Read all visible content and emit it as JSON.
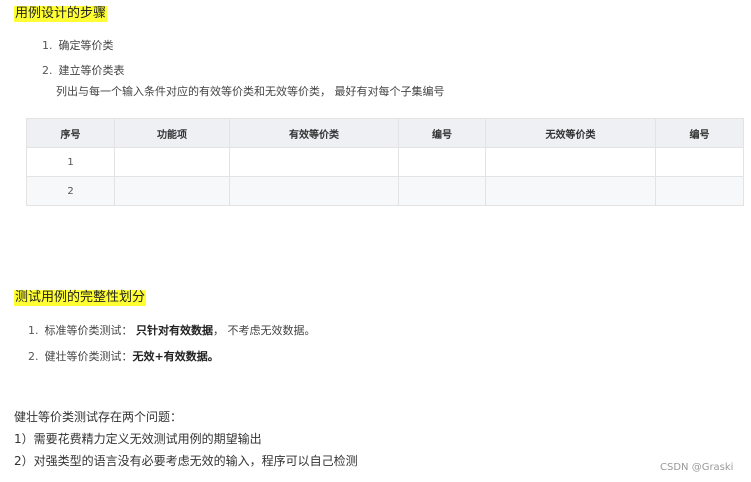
{
  "section1": {
    "title": "用例设计的步骤",
    "steps": [
      {
        "num": "1.",
        "text": "确定等价类"
      },
      {
        "num": "2.",
        "text": "建立等价类表"
      }
    ],
    "subtext": "列出与每一个输入条件对应的有效等价类和无效等价类， 最好有对每个子集编号"
  },
  "table": {
    "headers": [
      "序号",
      "功能项",
      "有效等价类",
      "编号",
      "无效等价类",
      "编号"
    ],
    "rows": [
      [
        "1",
        "",
        "",
        "",
        "",
        ""
      ],
      [
        "2",
        "",
        "",
        "",
        "",
        ""
      ]
    ]
  },
  "section2": {
    "title": "测试用例的完整性划分",
    "items": [
      {
        "num": "1.",
        "label": "标准等价类测试：",
        "bold": "只针对有效数据",
        "rest": "， 不考虑无效数据。"
      },
      {
        "num": "2.",
        "label": "健壮等价类测试：",
        "bold": "无效+有效数据。",
        "rest": ""
      }
    ]
  },
  "problems": {
    "intro": "健壮等价类测试存在两个问题：",
    "items": [
      "1）需要花费精力定义无效测试用例的期望输出",
      "2）对强类型的语言没有必要考虑无效的输入，程序可以自己检测"
    ]
  },
  "watermark": "CSDN @Graski"
}
